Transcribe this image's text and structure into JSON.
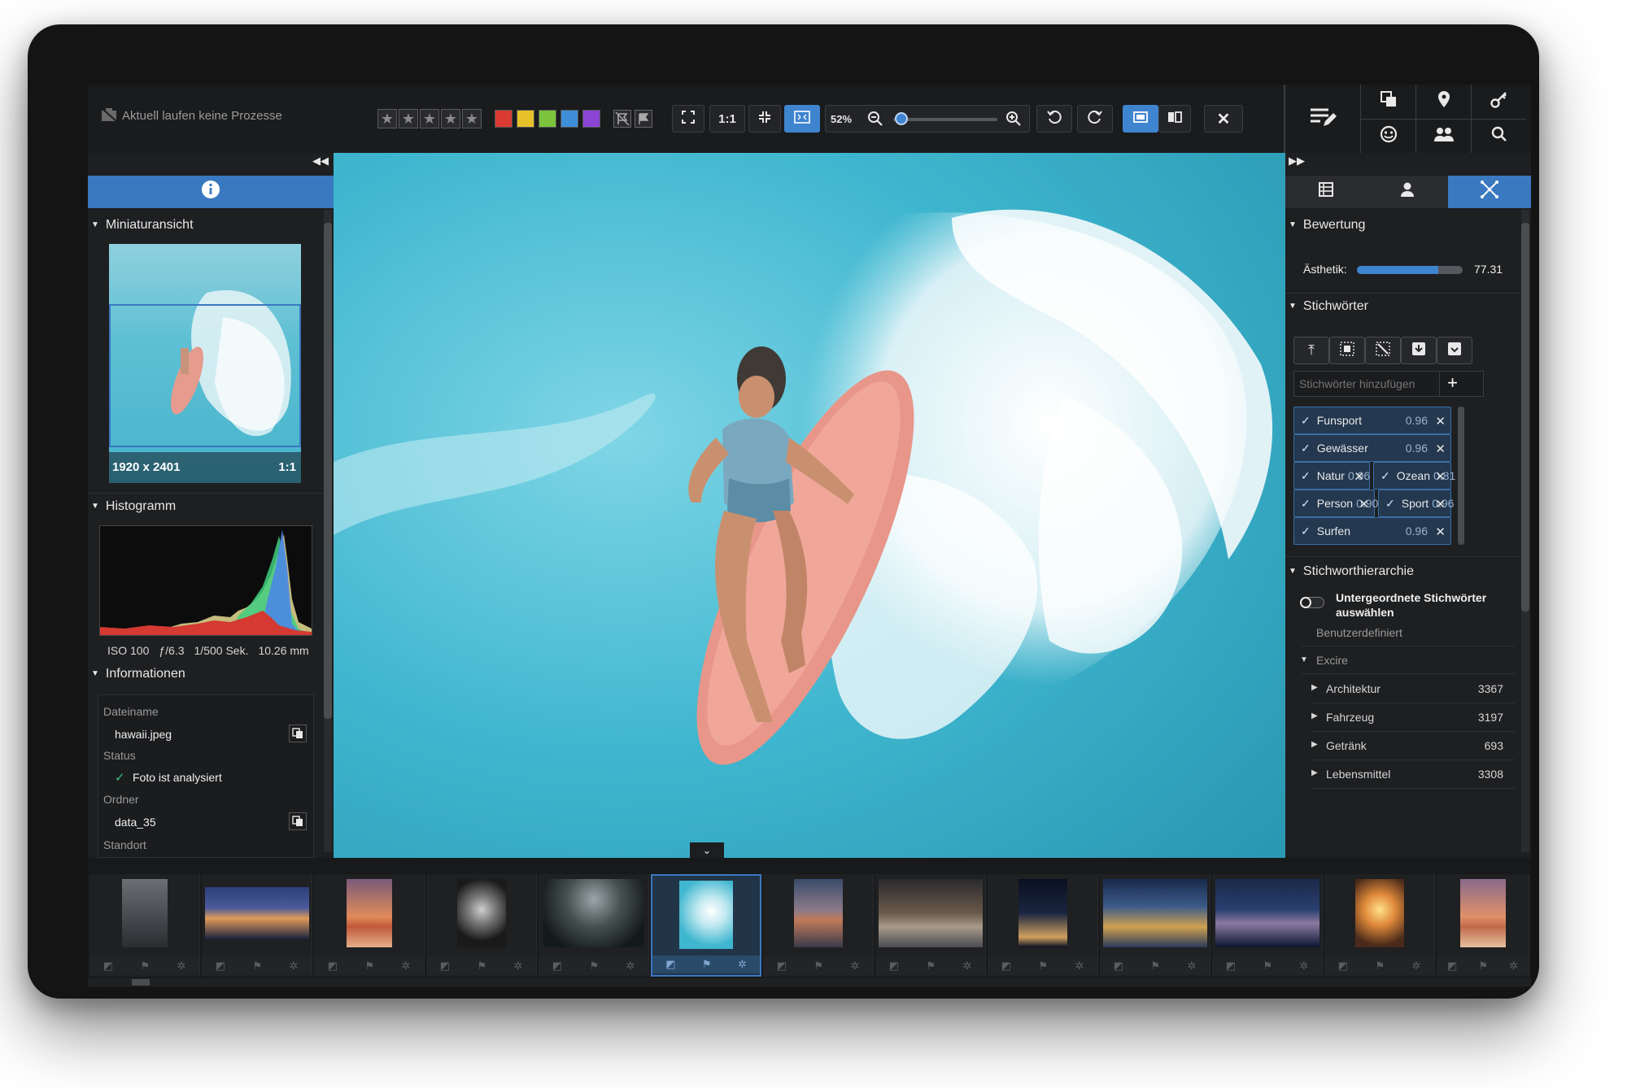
{
  "toolbar": {
    "status_text": "Aktuell laufen keine Prozesse",
    "stars": [
      "★",
      "★",
      "★",
      "★",
      "★"
    ],
    "color_labels": [
      "#d93a32",
      "#e6c12a",
      "#7bc43c",
      "#3f8fd8",
      "#8a45d4"
    ],
    "zoom_value": "52%",
    "zoom_fraction": 0.08,
    "one_to_one_label": "1:1",
    "close_glyph": "✕"
  },
  "left_panel": {
    "info_tab_icon": "info-icon",
    "thumbnail_section": "Miniaturansicht",
    "thumbnail_size": "1920 x 2401",
    "thumbnail_ratio": "1:1",
    "histogram_section": "Histogramm",
    "exif": {
      "iso": "ISO 100",
      "aperture": "ƒ/6.3",
      "shutter": "1/500 Sek.",
      "focal": "10.26 mm"
    },
    "info_section": "Informationen",
    "info": {
      "filename_label": "Dateiname",
      "filename_value": "hawaii.jpeg",
      "status_label": "Status",
      "status_value": "Foto ist analysiert",
      "folder_label": "Ordner",
      "folder_value": "data_35",
      "location_label": "Standort"
    }
  },
  "right_panel": {
    "rating_section": "Bewertung",
    "aesthetics_label": "Ästhetik:",
    "aesthetics_value": "77.31",
    "aesthetics_fraction": 0.77,
    "keywords_section": "Stichwörter",
    "keyword_input_placeholder": "Stichwörter hinzufügen",
    "keywords": [
      {
        "name": "Funsport",
        "score": "0.96"
      },
      {
        "name": "Gewässer",
        "score": "0.96"
      },
      {
        "name": "Natur",
        "score": "0.96"
      },
      {
        "name": "Ozean",
        "score": "0.81"
      },
      {
        "name": "Person",
        "score": "0.90"
      },
      {
        "name": "Sport",
        "score": "0.96"
      },
      {
        "name": "Surfen",
        "score": "0.96"
      }
    ],
    "hierarchy_section": "Stichworthierarchie",
    "subordinate_toggle_label": "Untergeordnete Stichwörter auswählen",
    "custom_label": "Benutzerdefiniert",
    "excire_label": "Excire",
    "hierarchy": [
      {
        "name": "Architektur",
        "count": "3367"
      },
      {
        "name": "Fahrzeug",
        "count": "3197"
      },
      {
        "name": "Getränk",
        "count": "693"
      },
      {
        "name": "Lebensmittel",
        "count": "3308"
      }
    ]
  },
  "colors": {
    "accent": "#3a78c0",
    "background": "#1d1e20"
  }
}
